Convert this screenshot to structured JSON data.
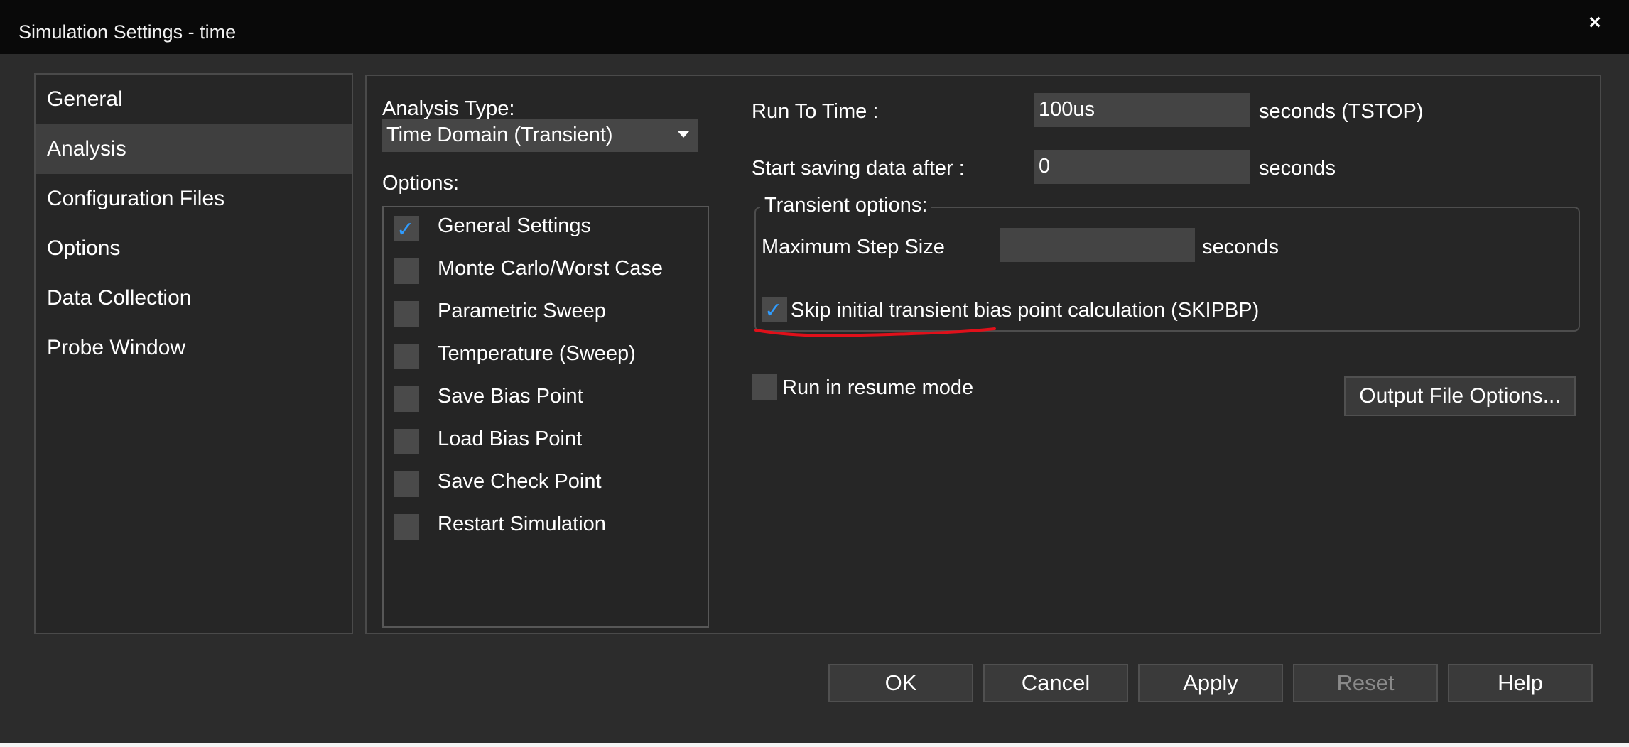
{
  "window": {
    "title": "Simulation Settings - time",
    "close_glyph": "×"
  },
  "nav": {
    "items": [
      "General",
      "Analysis",
      "Configuration Files",
      "Options",
      "Data Collection",
      "Probe Window"
    ],
    "selected": "Analysis"
  },
  "analysis": {
    "type_label": "Analysis Type:",
    "type_value": "Time Domain (Transient)",
    "options_label": "Options:",
    "options": [
      {
        "label": "General Settings",
        "checked": true
      },
      {
        "label": "Monte Carlo/Worst Case",
        "checked": false
      },
      {
        "label": "Parametric Sweep",
        "checked": false
      },
      {
        "label": "Temperature (Sweep)",
        "checked": false
      },
      {
        "label": "Save Bias Point",
        "checked": false
      },
      {
        "label": "Load Bias Point",
        "checked": false
      },
      {
        "label": "Save Check Point",
        "checked": false
      },
      {
        "label": "Restart Simulation",
        "checked": false
      }
    ]
  },
  "settings": {
    "run_to_time_label": "Run To Time :",
    "run_to_time_value": "100us",
    "run_to_time_unit": "seconds (TSTOP)",
    "start_saving_label": "Start saving data after :",
    "start_saving_value": "0",
    "start_saving_unit": "seconds",
    "transient_options_label": "Transient options:",
    "max_step_label": "Maximum Step Size",
    "max_step_value": "",
    "max_step_unit": "seconds",
    "skipbp_label": "Skip initial transient bias point calculation (SKIPBP)",
    "skipbp_checked": true,
    "resume_label": "Run in resume mode",
    "resume_checked": false,
    "output_file_options_label": "Output File Options..."
  },
  "buttons": {
    "ok": "OK",
    "cancel": "Cancel",
    "apply": "Apply",
    "reset": "Reset",
    "help": "Help"
  },
  "colors": {
    "check_accent": "#2f9cff",
    "annotation_red": "#e0101a"
  },
  "icons": {
    "check": "✓"
  }
}
